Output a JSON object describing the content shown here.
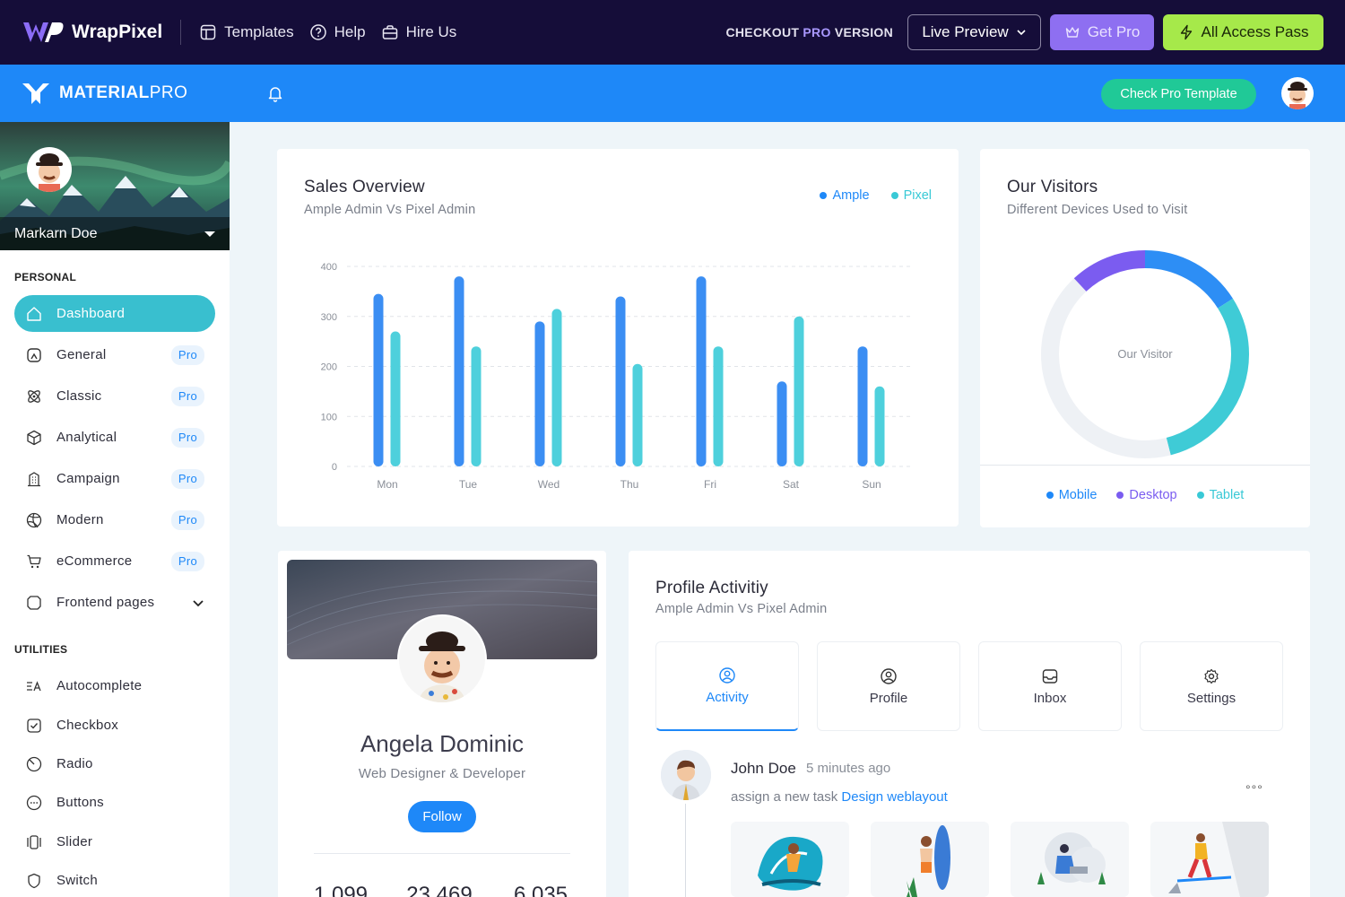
{
  "topbar": {
    "brand": "WrapPixel",
    "links": [
      {
        "label": "Templates",
        "icon": "templates-icon"
      },
      {
        "label": "Help",
        "icon": "help-icon"
      },
      {
        "label": "Hire Us",
        "icon": "briefcase-icon"
      }
    ],
    "checkout_prefix": "CHECKOUT",
    "checkout_pro": "PRO",
    "checkout_suffix": "VERSION",
    "live_preview": "Live Preview",
    "get_pro": "Get Pro",
    "all_access": "All Access Pass"
  },
  "header": {
    "brand_bold": "MATERIAL",
    "brand_light": "PRO",
    "check_pro": "Check Pro Template"
  },
  "sidebar": {
    "user_name": "Markarn Doe",
    "section_personal": "PERSONAL",
    "section_utilities": "UTILITIES",
    "personal_items": [
      {
        "label": "Dashboard",
        "badge": "",
        "icon": "home-icon"
      },
      {
        "label": "General",
        "badge": "Pro",
        "icon": "aperture-icon"
      },
      {
        "label": "Classic",
        "badge": "Pro",
        "icon": "atom-icon"
      },
      {
        "label": "Analytical",
        "badge": "Pro",
        "icon": "box-icon"
      },
      {
        "label": "Campaign",
        "badge": "Pro",
        "icon": "building-icon"
      },
      {
        "label": "Modern",
        "badge": "Pro",
        "icon": "ball-icon"
      },
      {
        "label": "eCommerce",
        "badge": "Pro",
        "icon": "cart-icon"
      },
      {
        "label": "Frontend pages",
        "badge": "",
        "icon": "app-window-icon"
      }
    ],
    "utility_items": [
      {
        "label": "Autocomplete",
        "icon": "autocomplete-icon"
      },
      {
        "label": "Checkbox",
        "icon": "checkbox-icon"
      },
      {
        "label": "Radio",
        "icon": "radio-icon"
      },
      {
        "label": "Buttons",
        "icon": "dots-circle-icon"
      },
      {
        "label": "Slider",
        "icon": "slider-icon"
      },
      {
        "label": "Switch",
        "icon": "shield-icon"
      }
    ]
  },
  "sales": {
    "title": "Sales Overview",
    "subtitle": "Ample Admin Vs Pixel Admin",
    "legend": [
      "Ample",
      "Pixel"
    ]
  },
  "chart_data": {
    "type": "bar",
    "categories": [
      "Mon",
      "Tue",
      "Wed",
      "Thu",
      "Fri",
      "Sat",
      "Sun"
    ],
    "series": [
      {
        "name": "Ample",
        "color": "#3b8ef3",
        "values": [
          345,
          380,
          290,
          340,
          380,
          170,
          240
        ]
      },
      {
        "name": "Pixel",
        "color": "#4ed0dc",
        "values": [
          270,
          240,
          315,
          205,
          240,
          300,
          160
        ]
      }
    ],
    "yticks": [
      0,
      100,
      200,
      300,
      400
    ],
    "ylim": [
      0,
      400
    ],
    "grid": true,
    "legend": "top-right"
  },
  "visitors": {
    "title": "Our Visitors",
    "subtitle": "Different Devices Used to Visit",
    "center_label": "Our Visitor",
    "legend": [
      {
        "label": "Mobile",
        "color": "#1e88f8"
      },
      {
        "label": "Desktop",
        "color": "#7a5cf0"
      },
      {
        "label": "Tablet",
        "color": "#39c9d6"
      }
    ]
  },
  "visitors_chart": {
    "type": "pie",
    "segments": [
      {
        "label": "Mobile",
        "color": "#2d8ef5",
        "fraction": 0.16
      },
      {
        "label": "Tablet",
        "color": "#3fcbd6",
        "fraction": 0.3
      },
      {
        "label": "Empty",
        "color": "#eef1f5",
        "fraction": 0.42
      },
      {
        "label": "Desktop",
        "color": "#7b5cf0",
        "fraction": 0.12
      }
    ]
  },
  "profile_card": {
    "name": "Angela Dominic",
    "role": "Web Designer & Developer",
    "follow": "Follow",
    "stats": [
      "1,099",
      "23,469",
      "6,035"
    ]
  },
  "activity": {
    "title": "Profile Activitiy",
    "subtitle": "Ample Admin Vs Pixel Admin",
    "tabs": [
      {
        "label": "Activity",
        "icon": "user-circle-icon"
      },
      {
        "label": "Profile",
        "icon": "user-circle-icon"
      },
      {
        "label": "Inbox",
        "icon": "inbox-icon"
      },
      {
        "label": "Settings",
        "icon": "gear-icon"
      }
    ],
    "entry": {
      "name": "John Doe",
      "time": "5 minutes ago",
      "text": "assign a new task",
      "link": "Design weblayout"
    }
  }
}
